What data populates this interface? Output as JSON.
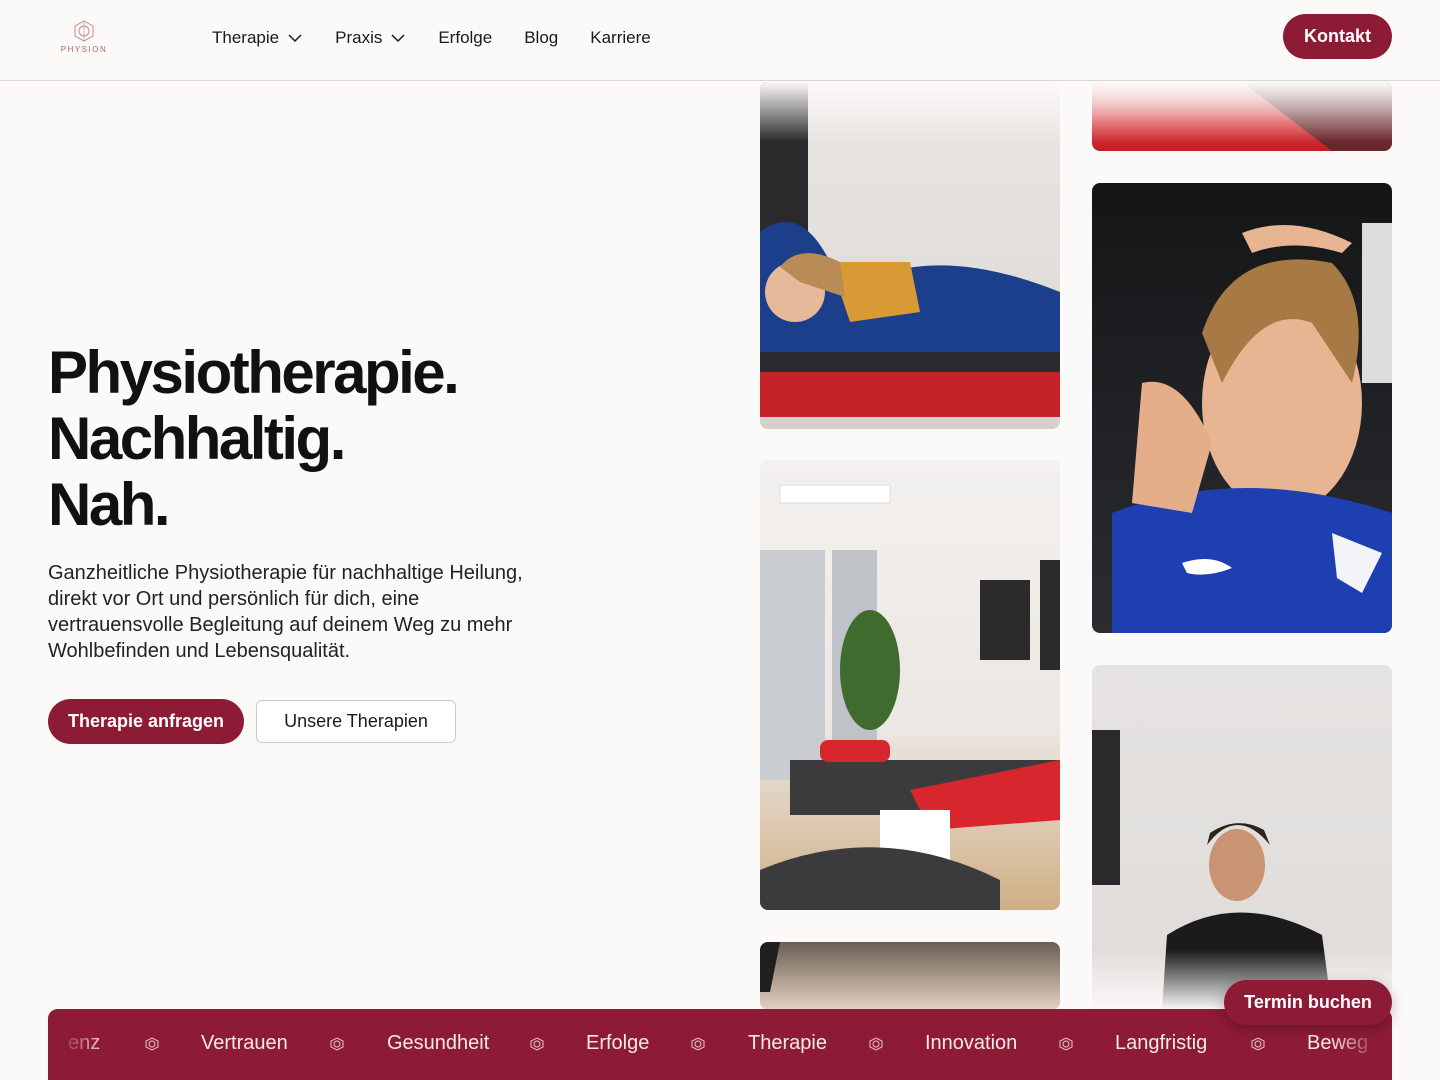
{
  "brand": {
    "name": "PHYSION",
    "accent_color": "#8e1b36"
  },
  "nav": {
    "items": [
      {
        "label": "Therapie",
        "has_dropdown": true
      },
      {
        "label": "Praxis",
        "has_dropdown": true
      },
      {
        "label": "Erfolge",
        "has_dropdown": false
      },
      {
        "label": "Blog",
        "has_dropdown": false
      },
      {
        "label": "Karriere",
        "has_dropdown": false
      }
    ],
    "cta_label": "Kontakt"
  },
  "hero": {
    "title_lines": [
      "Physiotherapie.",
      "Nachhaltig.",
      "Nah."
    ],
    "text": "Ganzheitliche Physiotherapie für nachhaltige Heilung, direkt vor Ort und persönlich für dich, eine vertrauensvolle Begleitung auf deinem Weg zu mehr Wohlbefinden und Lebensqualität.",
    "primary_label": "Therapie anfragen",
    "secondary_label": "Unsere Therapien"
  },
  "floating_cta": {
    "label": "Termin buchen"
  },
  "ticker": {
    "items": [
      "enz",
      "Vertrauen",
      "Gesundheit",
      "Erfolge",
      "Therapie",
      "Innovation",
      "Langfristig",
      "Beweg"
    ],
    "separator_icon": "physion-logo-icon"
  }
}
